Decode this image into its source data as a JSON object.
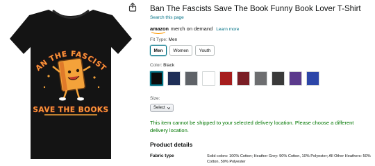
{
  "product": {
    "title": "Ban The Fascists Save The Book Funny Book Lover T-Shirt",
    "search_link": "Search this page",
    "brand_logo_text": "amazon",
    "brand_suffix": "merch on demand",
    "learn_more": "Learn more"
  },
  "fit": {
    "label_prefix": "Fit Type:",
    "selected": "Men",
    "options": [
      "Men",
      "Women",
      "Youth"
    ]
  },
  "color": {
    "label_prefix": "Color:",
    "selected": "Black",
    "swatches": [
      "#0b0b0b",
      "#1f2f57",
      "#5f6368",
      "#ffffff",
      "#a61d1d",
      "#7a1e25",
      "#6d6e70",
      "#3a3a3a",
      "#5b3a8c",
      "#2c46a8"
    ]
  },
  "size": {
    "label": "Size:",
    "select_value": "Select"
  },
  "delivery_message": "This item cannot be shipped to your selected delivery location. Please choose a different delivery location.",
  "product_details": {
    "heading": "Product details",
    "fabric_type_label": "Fabric type",
    "fabric_type_value": "Solid colors: 100% Cotton; Heather Grey: 90% Cotton, 10% Polyester; All Other Heathers: 50% Cotton, 50% Polyester"
  },
  "shirt_art": {
    "line1": "BAN THE FASCISTS",
    "line2": "SAVE THE BOOKS"
  },
  "colors": {
    "link": "#007185",
    "delivery_warning": "#007600",
    "shirt": "#141414",
    "art_orange": "#f4a23a"
  }
}
